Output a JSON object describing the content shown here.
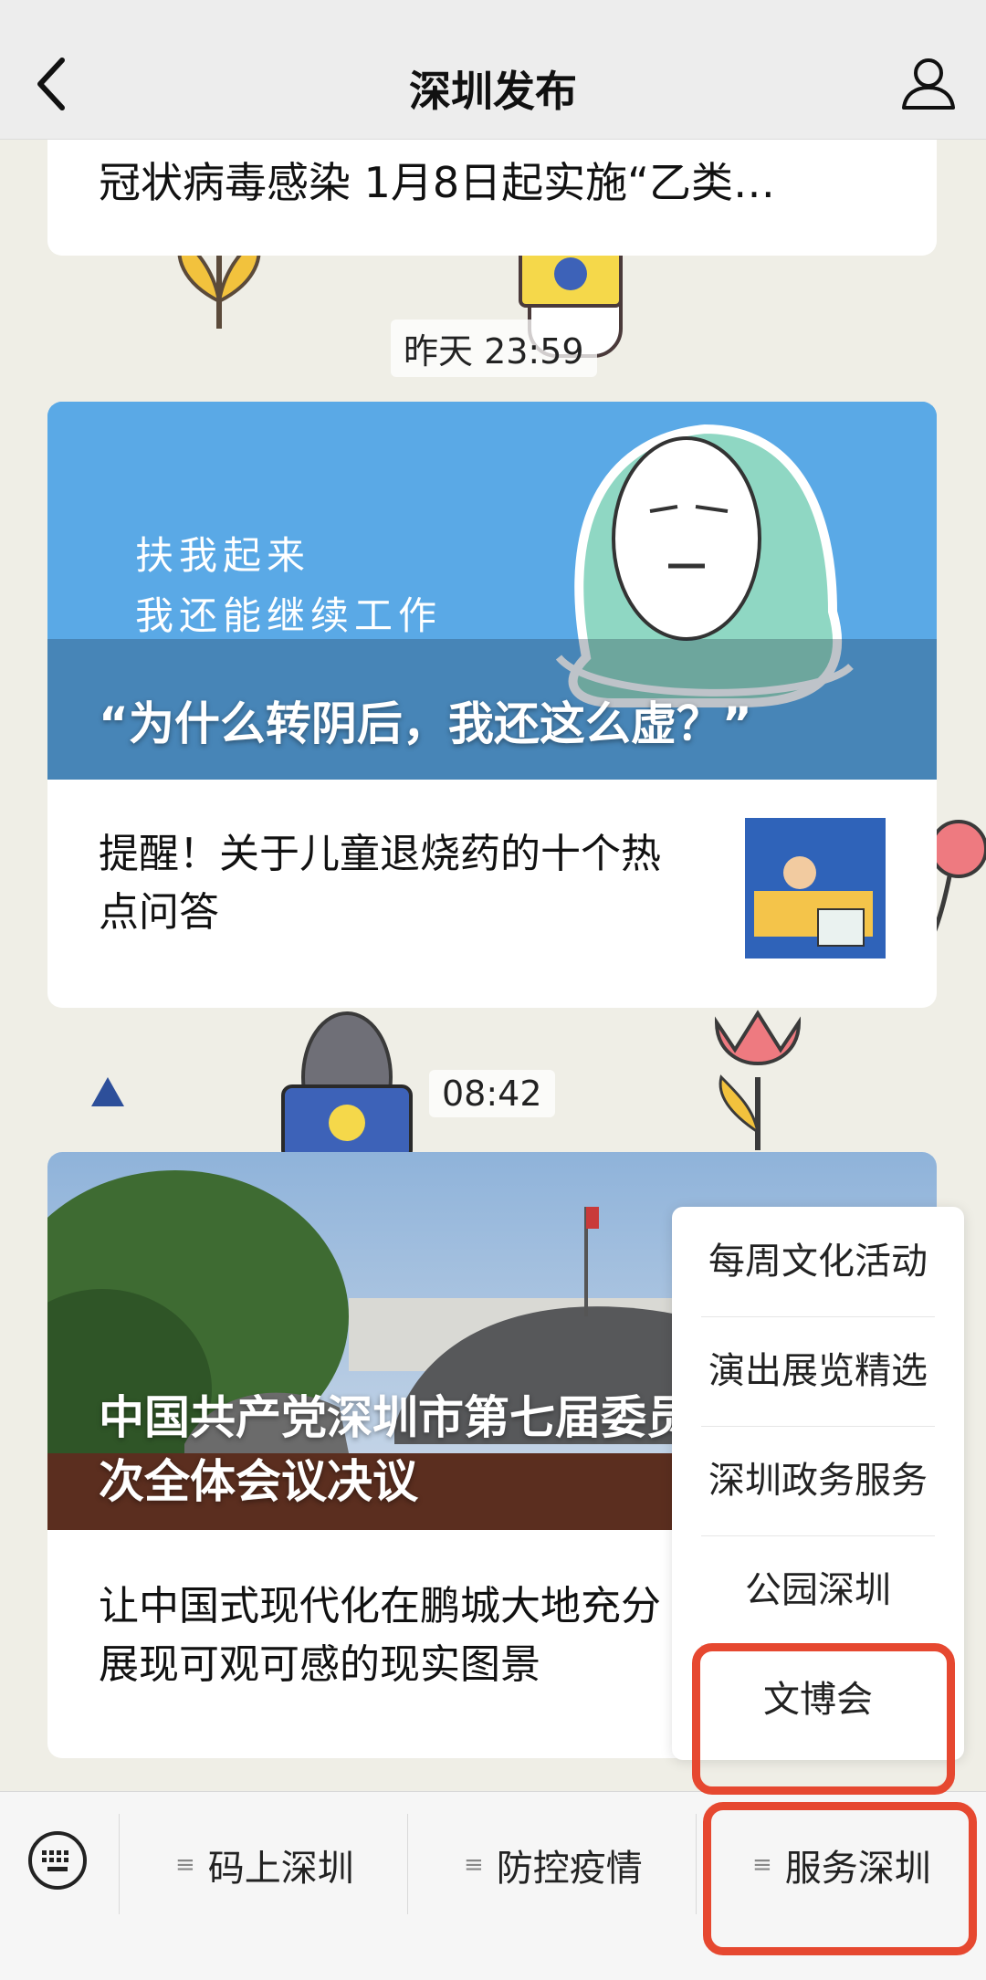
{
  "nav": {
    "title": "深圳发布",
    "back_icon": "chevron-left-icon",
    "profile_icon": "user-icon"
  },
  "feed": {
    "card1_text": "冠状病毒感染 1月8日起实施“乙类…",
    "time1": "昨天 23:59",
    "card2": {
      "hero_image_text_line1": "扶我起来",
      "hero_image_text_line2": "我还能继续工作",
      "hero_title": "“为什么转阴后，我还这么虚？”",
      "sub_line1": "提醒！关于儿童退烧药的十个热",
      "sub_line2": "点问答"
    },
    "time2": "08:42",
    "card3": {
      "hero_title_line1": "中国共产党深圳市第七届委员",
      "hero_title_line2": "次全体会议决议",
      "sub_line1": "让中国式现代化在鹏城大地充分",
      "sub_line2": "展现可观可感的现实图景"
    }
  },
  "menu": {
    "items": [
      "每周文化活动",
      "演出展览精选",
      "深圳政务服务",
      "公园深圳",
      "文博会"
    ],
    "highlighted_item": "文博会"
  },
  "bottom_bar": {
    "keyboard_icon": "keyboard-icon",
    "items": [
      "码上深圳",
      "防控疫情",
      "服务深圳"
    ],
    "highlighted_item": "服务深圳"
  },
  "colors": {
    "highlight": "#e64830",
    "nav_bg": "#ededed",
    "page_bg": "#efeee6",
    "hero_blue": "#5aa9e6"
  }
}
